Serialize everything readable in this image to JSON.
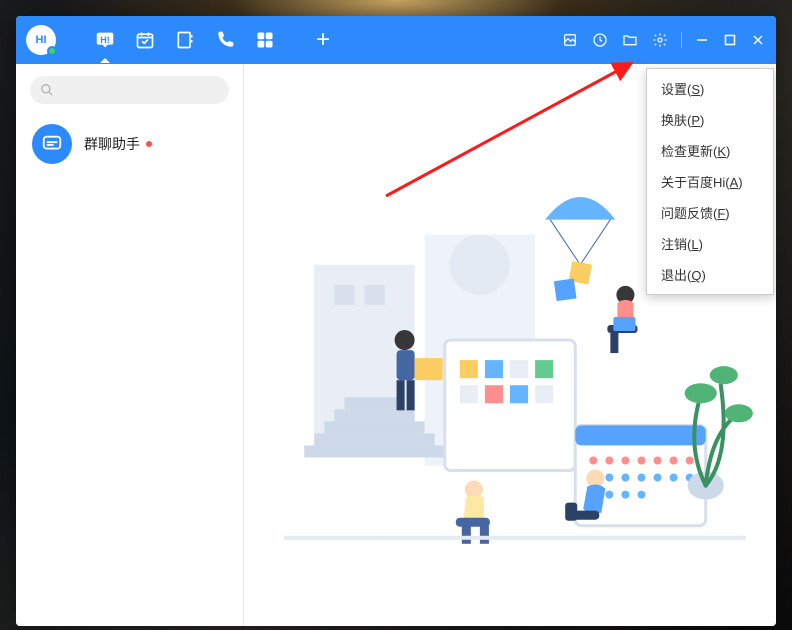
{
  "avatar_text": "HI",
  "nav": {
    "chat_badge": "H!",
    "add": "+"
  },
  "search": {
    "placeholder": ""
  },
  "sidebar": {
    "items": [
      {
        "label": "群聊助手"
      }
    ]
  },
  "menu": {
    "items": [
      {
        "label": "设置(",
        "hotkey": "S",
        "suffix": ")"
      },
      {
        "label": "换肤(",
        "hotkey": "P",
        "suffix": ")"
      },
      {
        "label": "检查更新(",
        "hotkey": "K",
        "suffix": ")"
      },
      {
        "label": "关于百度Hi(",
        "hotkey": "A",
        "suffix": ")"
      },
      {
        "label": "问题反馈(",
        "hotkey": "F",
        "suffix": ")"
      },
      {
        "label": "注销(",
        "hotkey": "L",
        "suffix": ")"
      },
      {
        "label": "退出(",
        "hotkey": "Q",
        "suffix": ")"
      }
    ]
  }
}
